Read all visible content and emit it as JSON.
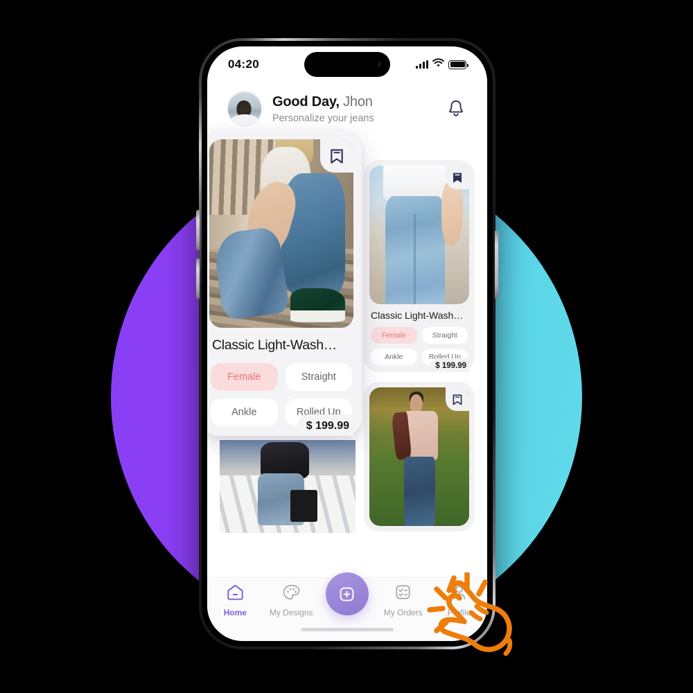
{
  "background": {
    "gradient_from": "#8B3FF5",
    "gradient_to": "#5BD6E8"
  },
  "phone": {
    "status_bar": {
      "time": "04:20",
      "signal_icon": "cellular-signal-icon",
      "wifi_icon": "wifi-icon",
      "battery_icon": "battery-icon"
    },
    "header": {
      "avatar_icon": "user-avatar",
      "greeting_bold": "Good Day,",
      "greeting_name": "Jhon",
      "subtitle": "Personalize your jeans",
      "bell_icon": "notification-bell-icon"
    },
    "products": [
      {
        "id": "featured",
        "title": "Classic Light-Wash…",
        "price": "$ 199.99",
        "bookmark_icon": "bookmark-outline-icon",
        "bookmarked": false,
        "photo": "woman-sitting-wearing-light-wash-jeans-green-sneakers",
        "tags": [
          {
            "label": "Female",
            "active": true
          },
          {
            "label": "Straight",
            "active": false
          },
          {
            "label": "Ankle",
            "active": false
          },
          {
            "label": "Rolled Up",
            "active": false
          }
        ]
      },
      {
        "id": "right-top",
        "title": "Classic Light-Wash…",
        "price": "$ 199.99",
        "bookmark_icon": "bookmark-filled-icon",
        "bookmarked": true,
        "photo": "woman-standing-light-blue-skinny-jeans-white-shirt",
        "tags": [
          {
            "label": "Female",
            "active": true
          },
          {
            "label": "Straight",
            "active": false
          },
          {
            "label": "Ankle",
            "active": false
          },
          {
            "label": "Rolled Up",
            "active": false
          }
        ]
      },
      {
        "id": "right-bottom",
        "bookmark_icon": "bookmark-outline-icon",
        "bookmarked": false,
        "photo": "man-in-field-holding-jacket-wearing-blue-jeans"
      },
      {
        "id": "left-bottom",
        "photo": "man-on-white-bridge-railing-ripped-jeans-black-jacket"
      }
    ],
    "bottom_nav": {
      "items": [
        {
          "label": "Home",
          "icon": "home-icon",
          "active": true
        },
        {
          "label": "My Designs",
          "icon": "palette-icon",
          "active": false
        },
        {
          "label": "My Orders",
          "icon": "checklist-icon",
          "active": false
        },
        {
          "label": "Profile",
          "icon": "user-profile-icon",
          "active": false
        }
      ],
      "add_button_icon": "add-plus-square-icon",
      "accent_color": "#7E5FD6",
      "add_button_color": "#9D8AD6"
    }
  },
  "cursor": {
    "icon": "tap-hand-cursor-icon",
    "color": "#EE7D0B"
  }
}
